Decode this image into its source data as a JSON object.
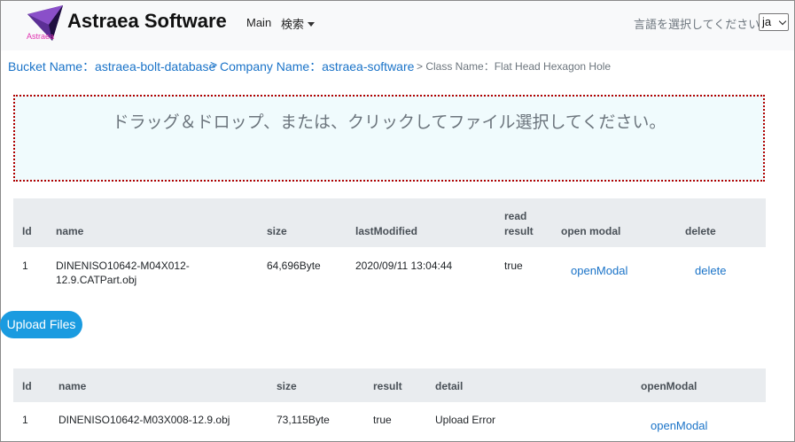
{
  "navbar": {
    "logo_text": "Astraea",
    "brand": "Astraea Software",
    "main_link": "Main",
    "search_menu": "検索",
    "lang_label": "言語を選択してください。",
    "lang_value": "ja"
  },
  "breadcrumb": {
    "bucket": "Bucket Name：astraea-bolt-database",
    "sep1": ">",
    "company": "Company Name：astraea-software",
    "class": "> Class Name：Flat Head Hexagon Hole"
  },
  "dropzone": {
    "text": "ドラッグ＆ドロップ、または、クリックしてファイル選択してください。"
  },
  "files_table": {
    "headers": [
      "Id",
      "name",
      "size",
      "lastModified",
      "read",
      "result",
      "open modal",
      "delete"
    ],
    "rows": [
      {
        "id": "1",
        "name_line1": "DINENISO10642-M04X012-",
        "name_line2": "12.9.CATPart.obj",
        "size": "64,696Byte",
        "lastModified": "2020/09/11 13:04:44",
        "read_result": "true",
        "open_modal": "openModal",
        "delete": "delete"
      }
    ]
  },
  "upload_button": "Upload Files",
  "results_table": {
    "headers": [
      "Id",
      "name",
      "size",
      "result",
      "detail",
      "openModal"
    ],
    "rows": [
      {
        "id": "1",
        "name": "DINENISO10642-M03X008-12.9.obj",
        "size": "73,115Byte",
        "result": "true",
        "detail": "Upload Error",
        "open_modal": "openModal"
      }
    ]
  },
  "colors": {
    "link": "#1a73c8",
    "button": "#1a9be0",
    "dropzone_border": "#b00000",
    "dropzone_bg": "#f0fbfd",
    "table_header_bg": "#e9ecef"
  }
}
